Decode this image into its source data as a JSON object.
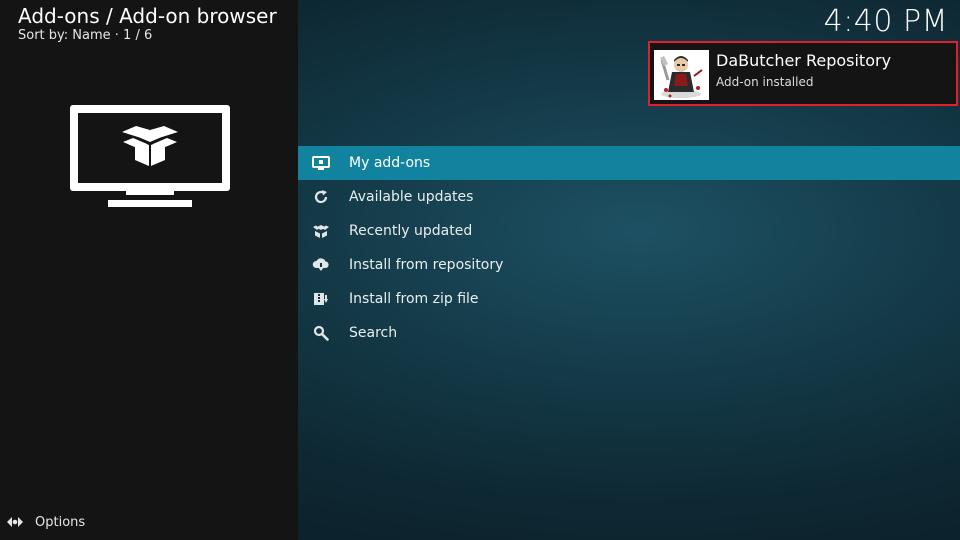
{
  "header": {
    "title": "Add-ons / Add-on browser",
    "subtitle": "Sort by: Name  ·  1 / 6"
  },
  "clock": "4:40 PM",
  "hero": {
    "icon": "addon-box-monitor-icon"
  },
  "menu": {
    "items": [
      {
        "label": "My add-ons",
        "icon": "monitor-icon",
        "active": true
      },
      {
        "label": "Available updates",
        "icon": "refresh-icon",
        "active": false
      },
      {
        "label": "Recently updated",
        "icon": "box-icon",
        "active": false
      },
      {
        "label": "Install from repository",
        "icon": "cloud-download-icon",
        "active": false
      },
      {
        "label": "Install from zip file",
        "icon": "zip-icon",
        "active": false
      },
      {
        "label": "Search",
        "icon": "search-icon",
        "active": false
      }
    ]
  },
  "notification": {
    "title": "DaButcher Repository",
    "message": "Add-on installed",
    "thumbnail": "repository-logo-icon"
  },
  "footer": {
    "options_label": "Options",
    "options_icon": "options-arrows-icon"
  },
  "colors": {
    "accent": "#12839f",
    "highlight_border": "#e0212b",
    "panel": "#141414"
  }
}
